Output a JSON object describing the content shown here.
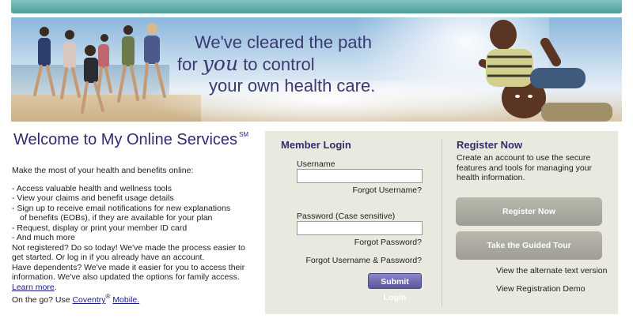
{
  "banner": {
    "line1": "We've cleared the path",
    "line2_pre": "for ",
    "line2_em": "you",
    "line2_post": " to control",
    "line3": "your own health care."
  },
  "welcome": {
    "title": "Welcome to My Online Services",
    "sup": "SM"
  },
  "intro": "Make the most of your health and benefits online:",
  "bullets": [
    "- Access valuable health and wellness tools",
    "- View your claims and benefit usage details",
    "- Sign up to receive email notifications for new explanations",
    "of benefits (EOBs), if they are available for your plan",
    "- Request, display or print your member ID card",
    "- And much more"
  ],
  "not_registered": "Not registered? Do so today! We've made the process easier to get started. Or log in if you already have an account.",
  "dependents": {
    "text": "Have dependents? We've made it easier for you to access their information. We've also updated the options for family access. ",
    "link": "Learn more",
    "end": "."
  },
  "on_the_go": {
    "text": "On the go? Use ",
    "link1": "Coventry",
    "reg": "®",
    "link2": "Mobile."
  },
  "login": {
    "title": "Member Login",
    "username_label": "Username",
    "username_value": "",
    "forgot_username": "Forgot Username?",
    "password_label": "Password (Case sensitive)",
    "password_value": "",
    "forgot_password": "Forgot Password?",
    "forgot_both": "Forgot Username & Password?",
    "submit": "Submit Login"
  },
  "register": {
    "title": "Register Now",
    "description": "Create an account to use the secure features and tools for managing your health information.",
    "register_button": "Register Now",
    "tour_button": "Take the Guided Tour",
    "alt_text": "View the alternate text version",
    "demo": "View Registration Demo"
  },
  "colors": {
    "brand_navy": "#2f2c70",
    "top_bar_teal": "#5fa9a5",
    "panel_bg": "#e9e9df",
    "submit_purple": "#5b56a0",
    "gray_button": "#a8a79d"
  }
}
